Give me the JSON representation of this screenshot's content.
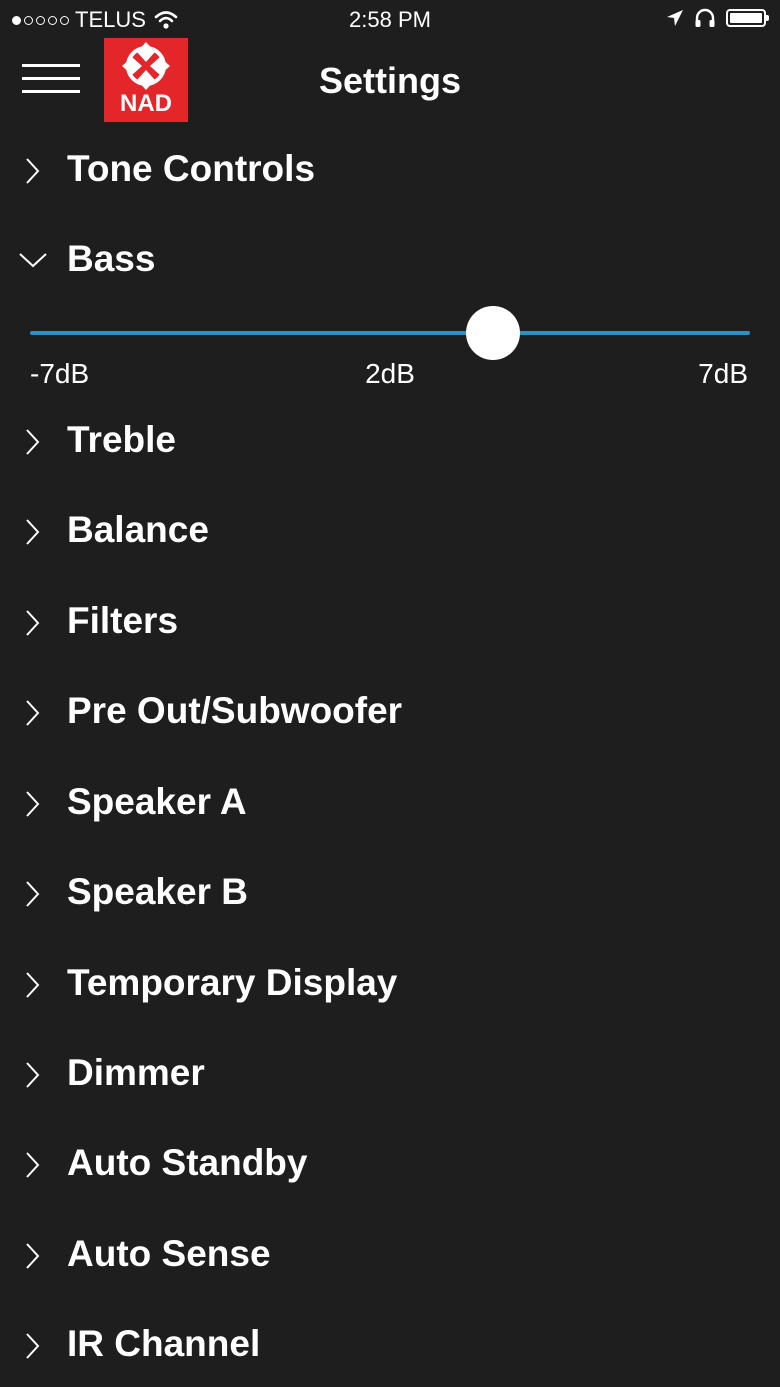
{
  "status_bar": {
    "carrier": "TELUS",
    "time": "2:58 PM",
    "signal_dots": [
      true,
      false,
      false,
      false,
      false
    ]
  },
  "header": {
    "title": "Settings",
    "logo_text": "NAD",
    "accent_color": "#e3262a"
  },
  "sections": [
    {
      "id": "tone-controls",
      "label": "Tone Controls",
      "expanded": false
    },
    {
      "id": "bass",
      "label": "Bass",
      "expanded": true
    },
    {
      "id": "treble",
      "label": "Treble",
      "expanded": false
    },
    {
      "id": "balance",
      "label": "Balance",
      "expanded": false
    },
    {
      "id": "filters",
      "label": "Filters",
      "expanded": false
    },
    {
      "id": "pre-out-subwoofer",
      "label": "Pre Out/Subwoofer",
      "expanded": false
    },
    {
      "id": "speaker-a",
      "label": "Speaker A",
      "expanded": false
    },
    {
      "id": "speaker-b",
      "label": "Speaker B",
      "expanded": false
    },
    {
      "id": "temporary-display",
      "label": "Temporary Display",
      "expanded": false
    },
    {
      "id": "dimmer",
      "label": "Dimmer",
      "expanded": false
    },
    {
      "id": "auto-standby",
      "label": "Auto Standby",
      "expanded": false
    },
    {
      "id": "auto-sense",
      "label": "Auto Sense",
      "expanded": false
    },
    {
      "id": "ir-channel",
      "label": "IR Channel",
      "expanded": false
    }
  ],
  "bass_slider": {
    "min_label": "-7dB",
    "value_label": "2dB",
    "max_label": "7dB",
    "min": -7,
    "max": 7,
    "value": 2,
    "track_color": "#2f8fbf"
  }
}
